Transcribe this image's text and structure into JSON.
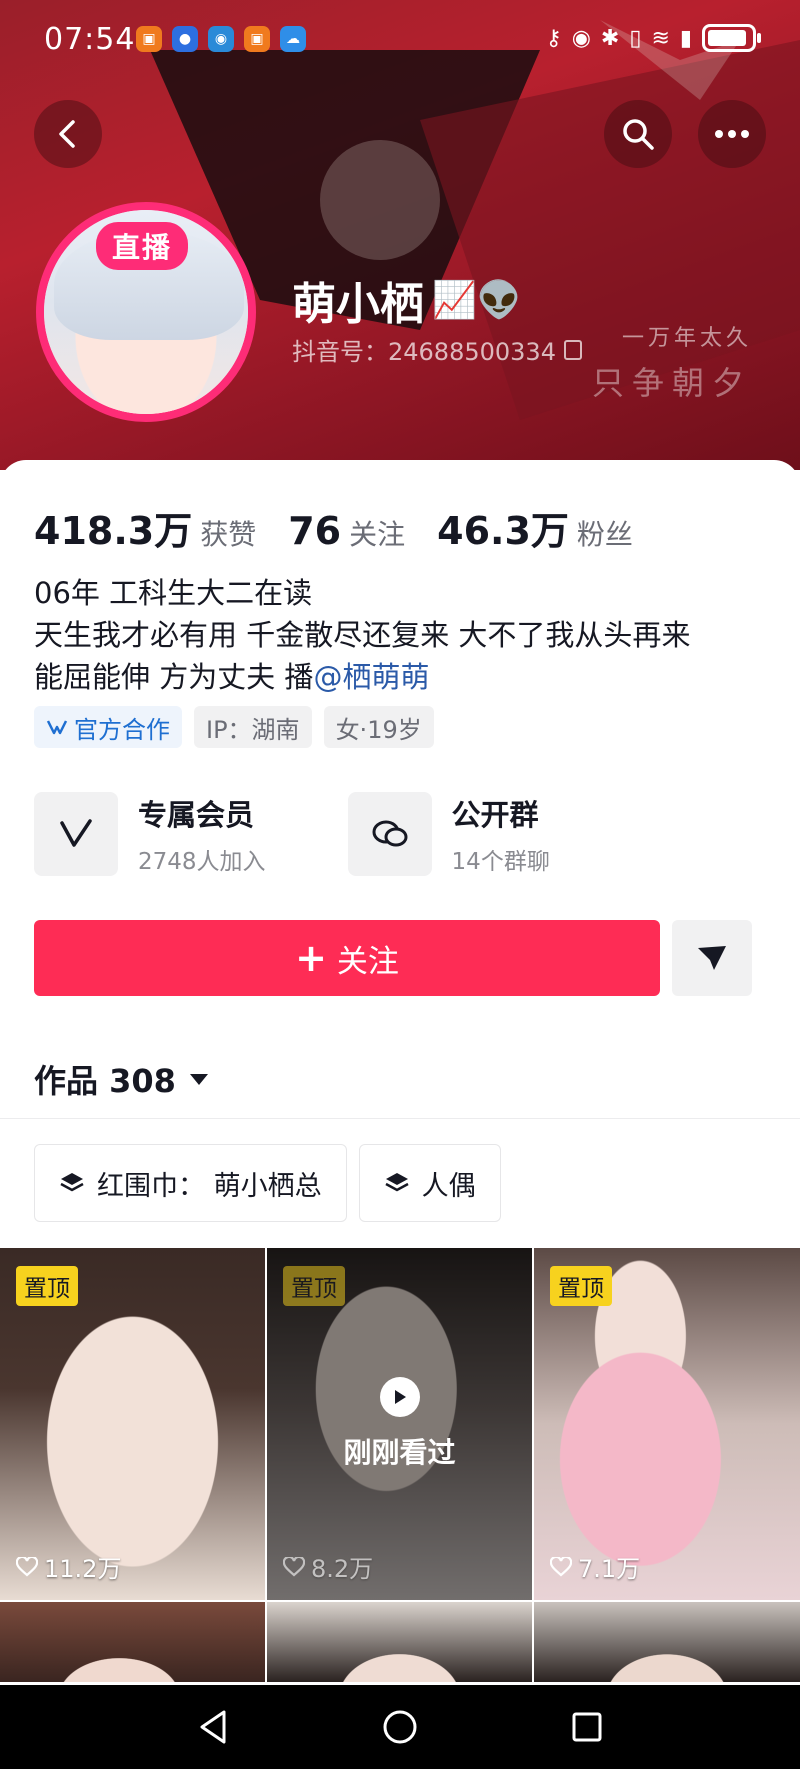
{
  "status_bar": {
    "time": "07:54"
  },
  "header": {
    "live_badge": "直播",
    "name": "萌小栖",
    "name_emoji": "📈👽",
    "douyin_id": "抖音号：24688500334",
    "motto_line1": "一万年太久",
    "motto_line2": "只争朝夕"
  },
  "stats": [
    {
      "value": "418.3万",
      "label": "获赞"
    },
    {
      "value": "76",
      "label": "关注"
    },
    {
      "value": "46.3万",
      "label": "粉丝"
    }
  ],
  "bio": {
    "line1": "06年  工科生大二在读",
    "line2": "天生我才必有用 千金散尽还复来 大不了我从头再来",
    "line3_prefix": "能屈能伸 方为丈夫   播",
    "line3_mention": "@栖萌萌"
  },
  "tags": {
    "official": "官方合作",
    "ip": "IP：湖南",
    "gender_age": "女·19岁"
  },
  "features": [
    {
      "title": "专属会员",
      "sub": "2748人加入",
      "icon": "v-icon"
    },
    {
      "title": "公开群",
      "sub": "14个群聊",
      "icon": "chat-icon"
    }
  ],
  "actions": {
    "follow_label": "关注",
    "follow_symbol": "+"
  },
  "works": {
    "label": "作品 308"
  },
  "collections": [
    {
      "label": "红围巾： 萌小栖总"
    },
    {
      "label": "人偶"
    }
  ],
  "videos": [
    {
      "pinned_label": "置顶",
      "likes": "11.2万",
      "bg": "#e8dcd3"
    },
    {
      "pinned_label": "置顶",
      "likes": "8.2万",
      "watched_label": "刚刚看过",
      "bg": "#cfc8c6"
    },
    {
      "pinned_label": "置顶",
      "likes": "7.1万",
      "bg": "#e9d3d6"
    },
    {
      "bg": "#7a4a3c"
    },
    {
      "bg": "#dad3cd"
    },
    {
      "bg": "#c9c2bd"
    }
  ],
  "colors": {
    "accent": "#fe2c55",
    "live": "#fe2c77",
    "pin": "#f7d21e",
    "banner": "#b8202e"
  }
}
